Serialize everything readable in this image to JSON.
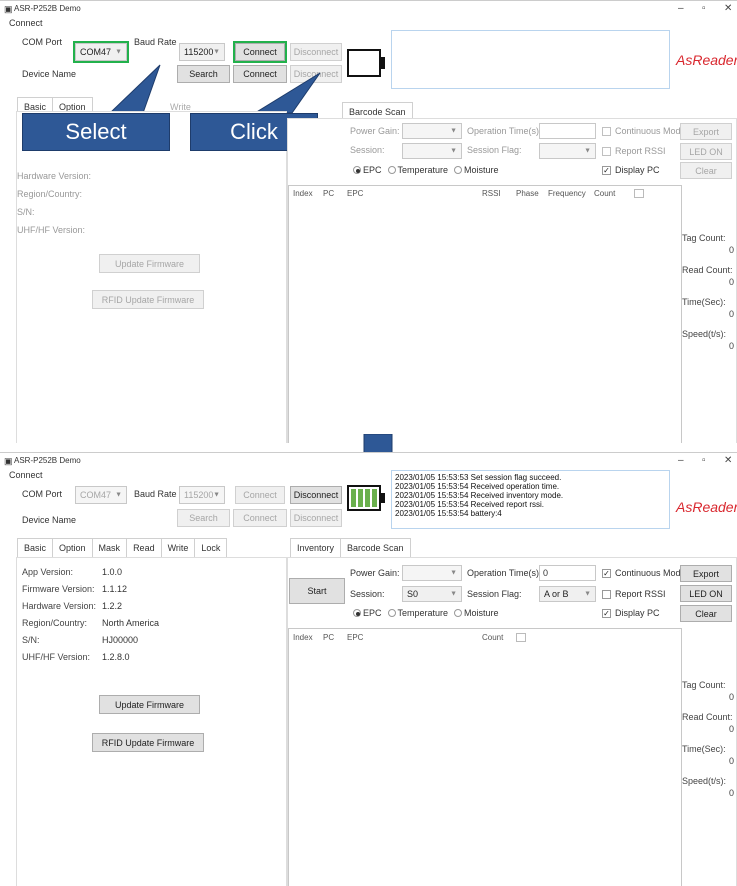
{
  "window_title": "ASR-P252B Demo",
  "window_buttons": {
    "min": "–",
    "max": "▫",
    "close": "✕"
  },
  "connect_group": "Connect",
  "com_port_label": "COM Port",
  "com_port_value": "COM47",
  "baud_rate_label": "Baud Rate",
  "baud_rate_value": "115200",
  "connect_button": "Connect",
  "disconnect_button": "Disconnect",
  "device_name_label": "Device Name",
  "search_button": "Search",
  "logo_text": "AsReader.",
  "annotations": {
    "select": "Select",
    "click": "Click"
  },
  "tabs_left": [
    "Basic",
    "Option",
    "Mask",
    "Read",
    "Write",
    "Lock"
  ],
  "tabs_right": [
    "Inventory",
    "Barcode Scan"
  ],
  "info_labels": [
    "App Version:",
    "Firmware Version:",
    "Hardware Version:",
    "Region/Country:",
    "S/N:",
    "UHF/HF Version:"
  ],
  "info_values": [
    "1.0.0",
    "1.1.12",
    "1.2.2",
    "North America",
    "HJ00000",
    "1.2.8.0"
  ],
  "update_firmware_button": "Update Firmware",
  "rfid_update_firmware_button": "RFID Update Firmware",
  "power_gain_label": "Power Gain:",
  "operation_time_label": "Operation Time(s):",
  "operation_time_value": "0",
  "session_label": "Session:",
  "session_value": "S0",
  "session_flag_label": "Session Flag:",
  "session_flag_value": "A or B",
  "continuous_mode_label": "Continuous Mode",
  "report_rssi_label": "Report RSSI",
  "display_pc_label": "Display PC",
  "radio_options": [
    "EPC",
    "Temperature",
    "Moisture"
  ],
  "export_button": "Export",
  "led_on_button": "LED ON",
  "clear_button": "Clear",
  "start_button": "Start",
  "table_headers_p1": [
    "Index",
    "PC",
    "EPC",
    "RSSI",
    "Phase",
    "Frequency",
    "Count"
  ],
  "table_headers_p2": [
    "Index",
    "PC",
    "EPC",
    "Count"
  ],
  "stats": [
    {
      "label": "Tag Count:",
      "value": "0"
    },
    {
      "label": "Read Count:",
      "value": "0"
    },
    {
      "label": "Time(Sec):",
      "value": "0"
    },
    {
      "label": "Speed(t/s):",
      "value": "0"
    }
  ],
  "log_lines": [
    "2023/01/05 15:53:53 Set session flag succeed.",
    "2023/01/05 15:53:54 Received operation time.",
    "2023/01/05 15:53:54 Received inventory mode.",
    "2023/01/05 15:53:54 Received report rssi.",
    "2023/01/05 15:53:54 battery:4"
  ],
  "battery_level": 4,
  "battery_max": 4,
  "colors": {
    "highlight": "#22b14c",
    "callout": "#2e5896",
    "battery": "#6ab04c",
    "logo": "#d9272e"
  }
}
